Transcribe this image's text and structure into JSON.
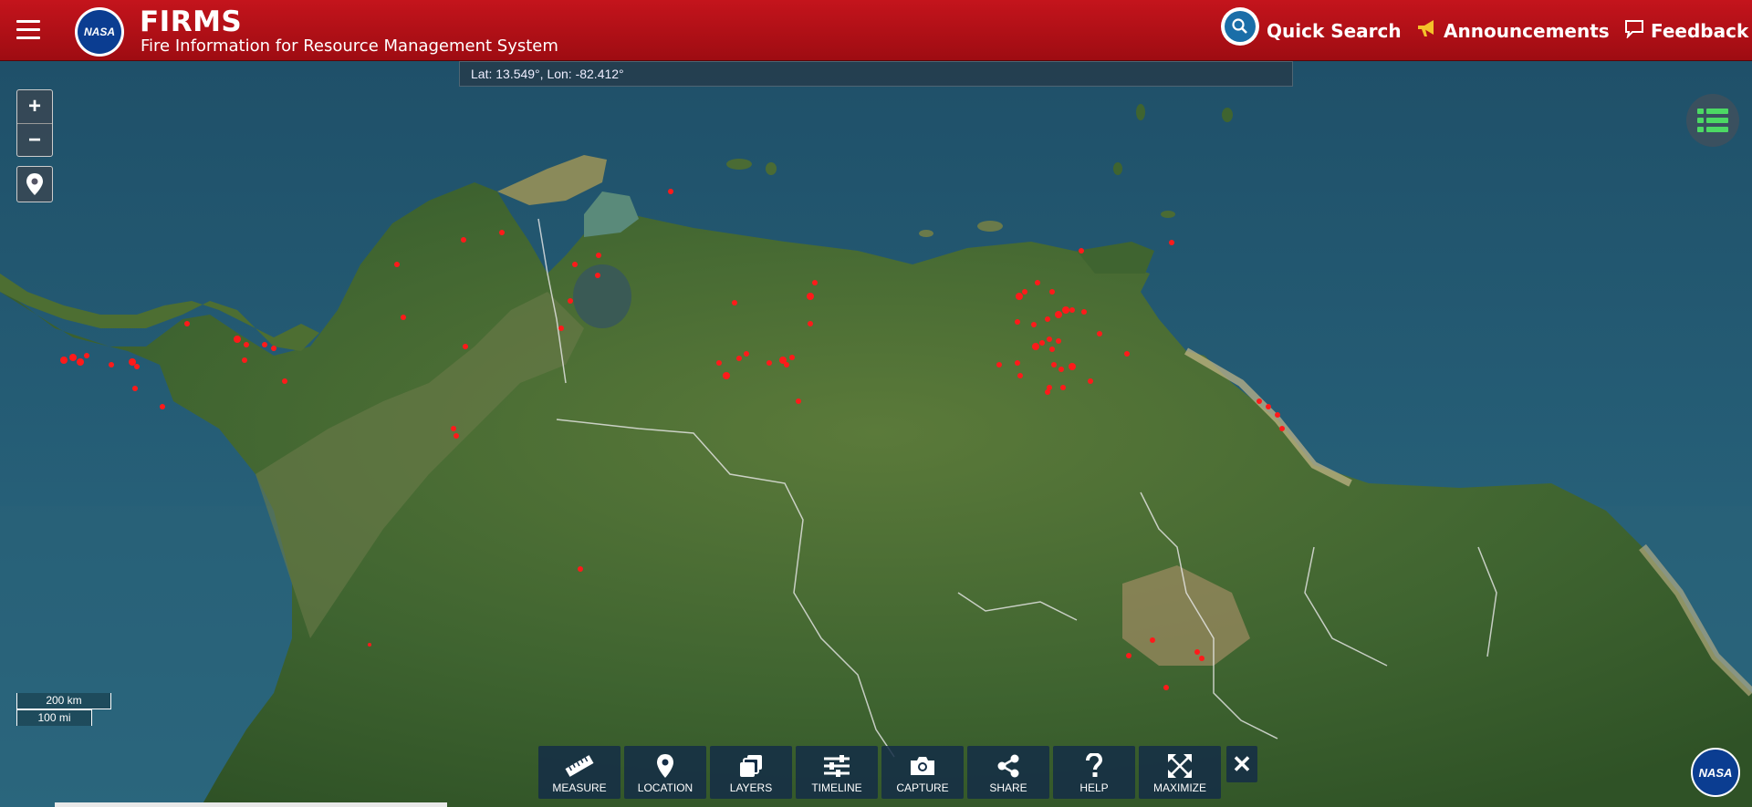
{
  "header": {
    "title": "FIRMS",
    "subtitle": "Fire Information for Resource Management System",
    "logo_text": "NASA",
    "quick_search": "Quick Search",
    "announcements": "Announcements",
    "feedback": "Feedback"
  },
  "map": {
    "coordinates": "Lat: 13.549°, Lon: -82.412°",
    "scale_km": "200 km",
    "scale_mi": "100 mi",
    "zoom_in": "+",
    "zoom_out": "−",
    "colors": {
      "ocean": "#2a5d74",
      "land": "#4a6b34",
      "fire": "#ff1a1a"
    }
  },
  "toolbar": {
    "items": [
      {
        "label": "MEASURE",
        "icon": "ruler-icon"
      },
      {
        "label": "LOCATION",
        "icon": "map-pin-icon"
      },
      {
        "label": "LAYERS",
        "icon": "layers-icon"
      },
      {
        "label": "TIMELINE",
        "icon": "sliders-icon"
      },
      {
        "label": "CAPTURE",
        "icon": "camera-icon"
      },
      {
        "label": "SHARE",
        "icon": "share-icon"
      },
      {
        "label": "HELP",
        "icon": "help-icon"
      },
      {
        "label": "MAXIMIZE",
        "icon": "maximize-icon"
      }
    ],
    "close": "✕"
  },
  "corner_logo": "NASA"
}
